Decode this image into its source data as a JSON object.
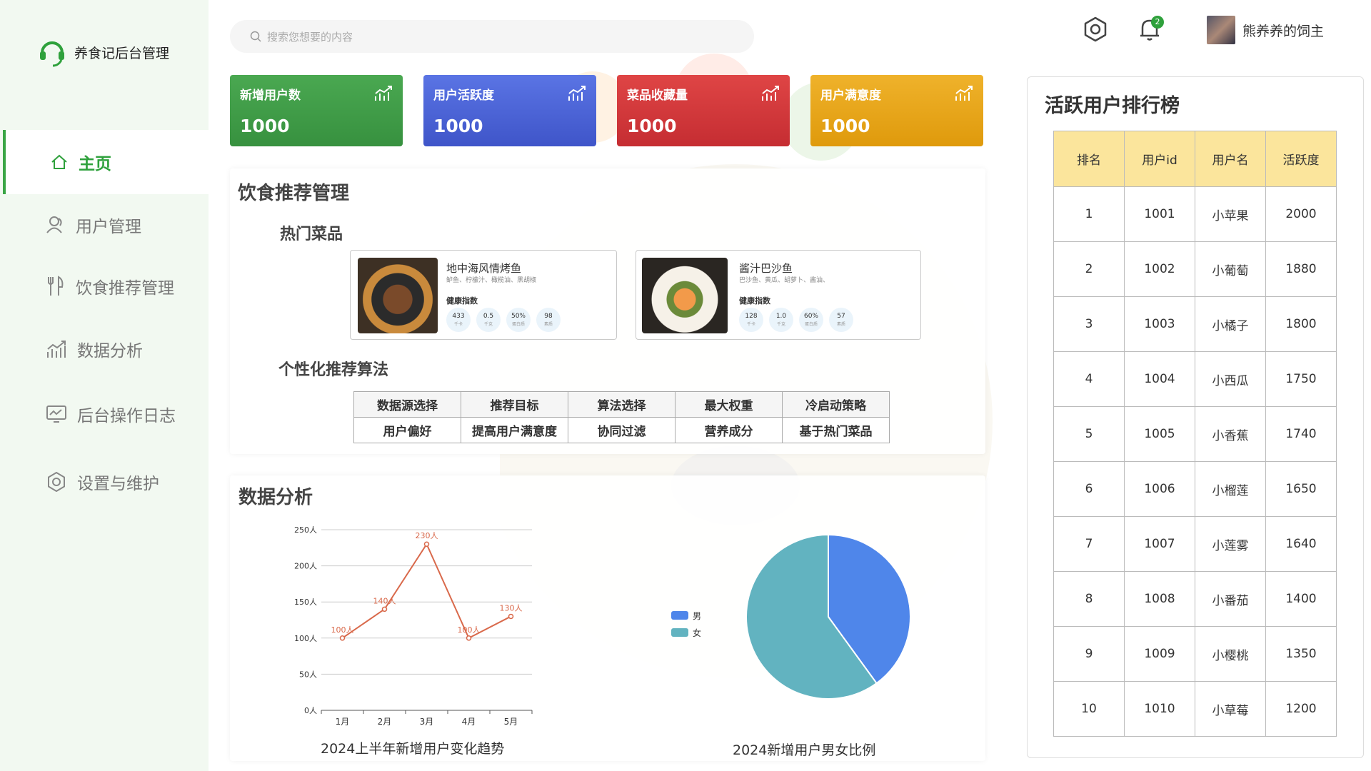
{
  "app": {
    "title": "养食记后台管理"
  },
  "sidebar": {
    "items": [
      {
        "label": "主页",
        "icon": "home-icon",
        "active": true
      },
      {
        "label": "用户管理",
        "icon": "user-icon"
      },
      {
        "label": "饮食推荐管理",
        "icon": "fork-knife-icon"
      },
      {
        "label": "数据分析",
        "icon": "chart-icon"
      },
      {
        "label": "后台操作日志",
        "icon": "log-icon"
      },
      {
        "label": "设置与维护",
        "icon": "gear-icon"
      }
    ]
  },
  "search": {
    "placeholder": "搜索您想要的内容"
  },
  "header": {
    "notification_count": "2",
    "user_name": "熊养养的饲主"
  },
  "stats": [
    {
      "label": "新增用户数",
      "value": "1000",
      "color": "#3f9b47"
    },
    {
      "label": "用户活跃度",
      "value": "1000",
      "color": "#4a63d8"
    },
    {
      "label": "菜品收藏量",
      "value": "1000",
      "color": "#d23a3a"
    },
    {
      "label": "用户满意度",
      "value": "1000",
      "color": "#e8a416"
    }
  ],
  "diet": {
    "title": "饮食推荐管理",
    "hot_title": "热门菜品",
    "dishes": [
      {
        "name": "地中海风情烤鱼",
        "desc": "鲈鱼、柠檬汁、橄榄油、黑胡椒",
        "health_label": "健康指数",
        "metrics": [
          {
            "v": "433",
            "u": "千卡"
          },
          {
            "v": "0.5",
            "u": "千克"
          },
          {
            "v": "50%",
            "u": "蛋白质"
          },
          {
            "v": "98",
            "u": "素质"
          }
        ]
      },
      {
        "name": "酱汁巴沙鱼",
        "desc": "巴沙鱼、黄瓜、胡萝卜、酱油、",
        "health_label": "健康指数",
        "metrics": [
          {
            "v": "128",
            "u": "千卡"
          },
          {
            "v": "1.0",
            "u": "千克"
          },
          {
            "v": "60%",
            "u": "蛋白质"
          },
          {
            "v": "57",
            "u": "素质"
          }
        ]
      }
    ],
    "algo_title": "个性化推荐算法",
    "algo_headers": [
      "数据源选择",
      "推荐目标",
      "算法选择",
      "最大权重",
      "冷启动策略"
    ],
    "algo_values": [
      "用户偏好",
      "提高用户满意度",
      "协同过滤",
      "营养成分",
      "基于热门菜品"
    ]
  },
  "analysis": {
    "title": "数据分析",
    "line_caption": "2024上半年新增用户变化趋势",
    "pie_caption": "2024新增用户男女比例"
  },
  "chart_data": [
    {
      "type": "line",
      "categories": [
        "1月",
        "2月",
        "3月",
        "4月",
        "5月"
      ],
      "values": [
        100,
        140,
        230,
        100,
        130
      ],
      "data_labels": [
        "100人",
        "140人",
        "230人",
        "100人",
        "130人"
      ],
      "ylim": [
        0,
        250
      ],
      "yticks": [
        "0人",
        "50人",
        "100人",
        "150人",
        "200人",
        "250人"
      ],
      "title": "2024上半年新增用户变化趋势",
      "color": "#d9694b",
      "grid": true
    },
    {
      "type": "pie",
      "title": "2024新增用户男女比例",
      "series": [
        {
          "name": "男",
          "value": 40,
          "color": "#4f86ea"
        },
        {
          "name": "女",
          "value": 60,
          "color": "#62b3c0"
        }
      ],
      "legend": "left"
    }
  ],
  "rank": {
    "title": "活跃用户排行榜",
    "headers": [
      "排名",
      "用户id",
      "用户名",
      "活跃度"
    ],
    "rows": [
      [
        "1",
        "1001",
        "小苹果",
        "2000"
      ],
      [
        "2",
        "1002",
        "小葡萄",
        "1880"
      ],
      [
        "3",
        "1003",
        "小橘子",
        "1800"
      ],
      [
        "4",
        "1004",
        "小西瓜",
        "1750"
      ],
      [
        "5",
        "1005",
        "小香蕉",
        "1740"
      ],
      [
        "6",
        "1006",
        "小榴莲",
        "1650"
      ],
      [
        "7",
        "1007",
        "小莲雾",
        "1640"
      ],
      [
        "8",
        "1008",
        "小番茄",
        "1400"
      ],
      [
        "9",
        "1009",
        "小樱桃",
        "1350"
      ],
      [
        "10",
        "1010",
        "小草莓",
        "1200"
      ]
    ]
  }
}
